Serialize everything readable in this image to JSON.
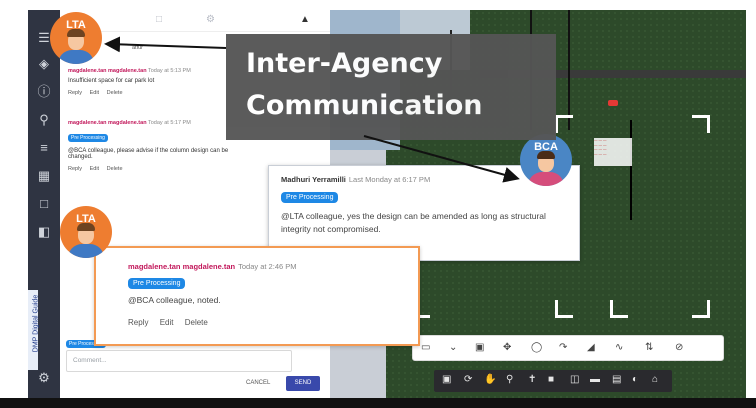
{
  "title": {
    "line1": "Inter-Agency",
    "line2": "Communication"
  },
  "side_label": "DMP Digital Guide",
  "avatars": {
    "lta_top": "LTA",
    "lta_bottom": "LTA",
    "bca": "BCA"
  },
  "panel": {
    "author_snippet": "atfur",
    "comments": [
      {
        "author": "magdalene.tan magdalene.tan",
        "time": "Today at 5:13 PM",
        "text": "Insufficient space for car park lot",
        "actions": [
          "Reply",
          "Edit",
          "Delete"
        ]
      },
      {
        "author": "magdalene.tan magdalene.tan",
        "time": "Today at 5:17 PM",
        "tag": "Pre Processing",
        "text": "@BCA colleague, please advise if the column design can be changed.",
        "actions": [
          "Reply",
          "Edit",
          "Delete"
        ]
      }
    ],
    "compose": {
      "tag": "Pre Processing",
      "placeholder": "Comment...",
      "cancel": "CANCEL",
      "send": "SEND"
    }
  },
  "bca_popup": {
    "author": "Madhuri Yerramilli",
    "time": "Last Monday at 6:17 PM",
    "tag": "Pre Processing",
    "text": "@LTA colleague, yes the design can be amended as long as structural integrity not compromised."
  },
  "lta_popup": {
    "author": "magdalene.tan magdalene.tan",
    "time": "Today at 2:46 PM",
    "tag": "Pre Processing",
    "text": "@BCA colleague, noted.",
    "actions": [
      "Reply",
      "Edit",
      "Delete"
    ]
  },
  "colors": {
    "accent": "#1e88e5",
    "lta_border": "#f39a53",
    "send": "#3949ab",
    "lta_avatar": "#ee7d30",
    "bca_avatar": "#4a86c5"
  }
}
